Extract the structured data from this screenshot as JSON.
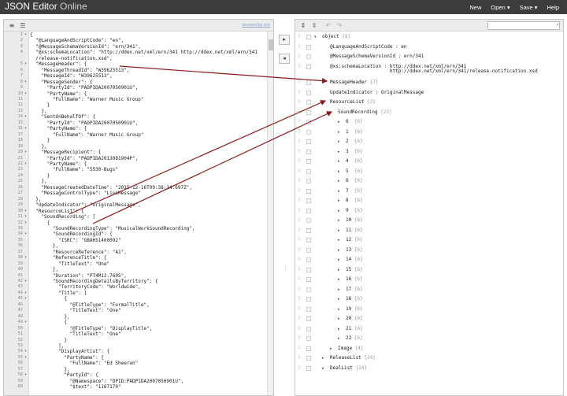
{
  "app": {
    "title_main": "JSON Editor",
    "title_sub": " Online"
  },
  "header_menu": [
    "New",
    "Open ▾",
    "Save ▾",
    "Help"
  ],
  "left_panel": {
    "powered_by": "powered by ace",
    "lines": [
      {
        "n": "1",
        "f": "▾",
        "t": "{"
      },
      {
        "n": "2",
        "f": "",
        "t": "  \"@LanguageAndScriptCode\": \"en\","
      },
      {
        "n": "3",
        "f": "",
        "t": "  \"@MessageSchemaVersionId\": \"ern/341\","
      },
      {
        "n": "4",
        "f": "",
        "t": "  \"@xs:schemaLocation\": \"http://ddex.net/xml/ern/341 http://ddex.net/xml/ern/341"
      },
      {
        "n": "",
        "f": "",
        "t": "  /release-notification.xsd\","
      },
      {
        "n": "5",
        "f": "▾",
        "t": "  \"MessageHeader\": {"
      },
      {
        "n": "6",
        "f": "",
        "t": "    \"MessageThreadId\": \"W39625513\","
      },
      {
        "n": "7",
        "f": "",
        "t": "    \"MessageId\": \"W39625513\","
      },
      {
        "n": "8",
        "f": "▾",
        "t": "    \"MessageSender\": {"
      },
      {
        "n": "9",
        "f": "",
        "t": "      \"PartyId\": \"PADPIDA2007050901U\","
      },
      {
        "n": "10",
        "f": "▾",
        "t": "      \"PartyName\": {"
      },
      {
        "n": "11",
        "f": "",
        "t": "        \"FullName\": \"Warner Music Group\""
      },
      {
        "n": "12",
        "f": "",
        "t": "      }"
      },
      {
        "n": "13",
        "f": "",
        "t": "    },"
      },
      {
        "n": "14",
        "f": "▾",
        "t": "    \"SentOnBehalfOf\": {"
      },
      {
        "n": "15",
        "f": "",
        "t": "      \"PartyId\": \"PADPIDA2007050901U\","
      },
      {
        "n": "16",
        "f": "▾",
        "t": "      \"PartyName\": {"
      },
      {
        "n": "17",
        "f": "",
        "t": "        \"FullName\": \"Warner Music Group\""
      },
      {
        "n": "18",
        "f": "",
        "t": "      }"
      },
      {
        "n": "19",
        "f": "",
        "t": "    },"
      },
      {
        "n": "20",
        "f": "▾",
        "t": "    \"MessageRecipient\": {"
      },
      {
        "n": "21",
        "f": "",
        "t": "      \"PartyId\": \"PADPIDA2013081904P\","
      },
      {
        "n": "22",
        "f": "▾",
        "t": "      \"PartyName\": {"
      },
      {
        "n": "23",
        "f": "",
        "t": "        \"FullName\": \"5530-Bugs\""
      },
      {
        "n": "24",
        "f": "",
        "t": "      }"
      },
      {
        "n": "25",
        "f": "",
        "t": "    },"
      },
      {
        "n": "26",
        "f": "",
        "t": "    \"MessageCreatedDateTime\": \"2015-12-16T09:38:14.697Z\","
      },
      {
        "n": "27",
        "f": "",
        "t": "    \"MessageControlType\": \"LiveMessage\""
      },
      {
        "n": "28",
        "f": "",
        "t": "  },"
      },
      {
        "n": "29",
        "f": "",
        "t": "  \"UpdateIndicator\": \"OriginalMessage\","
      },
      {
        "n": "30",
        "f": "▾",
        "t": "  \"ResourceList\": {"
      },
      {
        "n": "31",
        "f": "▾",
        "t": "    \"SoundRecording\": ["
      },
      {
        "n": "32",
        "f": "▾",
        "t": "      {"
      },
      {
        "n": "33",
        "f": "",
        "t": "        \"SoundRecordingType\": \"MusicalWorkSoundRecording\","
      },
      {
        "n": "34",
        "f": "▾",
        "t": "        \"SoundRecordingId\": {"
      },
      {
        "n": "35",
        "f": "",
        "t": "          \"ISRC\": \"GBAHS1400092\""
      },
      {
        "n": "36",
        "f": "",
        "t": "        },"
      },
      {
        "n": "37",
        "f": "",
        "t": "        \"ResourceReference\": \"A1\","
      },
      {
        "n": "38",
        "f": "▾",
        "t": "        \"ReferenceTitle\": {"
      },
      {
        "n": "39",
        "f": "",
        "t": "          \"TitleText\": \"One\""
      },
      {
        "n": "40",
        "f": "",
        "t": "        },"
      },
      {
        "n": "41",
        "f": "",
        "t": "        \"Duration\": \"PT4M12.760S\","
      },
      {
        "n": "42",
        "f": "▾",
        "t": "        \"SoundRecordingDetailsByTerritory\": {"
      },
      {
        "n": "43",
        "f": "",
        "t": "          \"TerritoryCode\": \"Worldwide\","
      },
      {
        "n": "44",
        "f": "▾",
        "t": "          \"Title\": ["
      },
      {
        "n": "45",
        "f": "▾",
        "t": "            {"
      },
      {
        "n": "46",
        "f": "",
        "t": "              \"@TitleType\": \"FormalTitle\","
      },
      {
        "n": "47",
        "f": "",
        "t": "              \"TitleText\": \"One\""
      },
      {
        "n": "48",
        "f": "",
        "t": "            },"
      },
      {
        "n": "49",
        "f": "▾",
        "t": "            {"
      },
      {
        "n": "50",
        "f": "",
        "t": "              \"@TitleType\": \"DisplayTitle\","
      },
      {
        "n": "51",
        "f": "",
        "t": "              \"TitleText\": \"One\""
      },
      {
        "n": "52",
        "f": "",
        "t": "            }"
      },
      {
        "n": "53",
        "f": "",
        "t": "          ],"
      },
      {
        "n": "54",
        "f": "▾",
        "t": "          \"DisplayArtist\": {"
      },
      {
        "n": "55",
        "f": "▾",
        "t": "            \"PartyName\": {"
      },
      {
        "n": "56",
        "f": "",
        "t": "              \"FullName\": \"Ed Sheeran\""
      },
      {
        "n": "57",
        "f": "",
        "t": "            },"
      },
      {
        "n": "58",
        "f": "▾",
        "t": "            \"PartyId\": {"
      },
      {
        "n": "59",
        "f": "",
        "t": "              \"@Namespace\": \"DPID:PADPIDA2007050901U\","
      },
      {
        "n": "60",
        "f": "",
        "t": "              \"$text\": \"1167170\""
      }
    ]
  },
  "middle_buttons": [
    "▸",
    "◂"
  ],
  "right_panel": {
    "search_placeholder": "",
    "tree": [
      {
        "indent": 0,
        "exp": "▾",
        "key": "object",
        "meta": " {8}"
      },
      {
        "indent": 1,
        "exp": "",
        "key": "@LanguageAndScriptCode : en",
        "meta": ""
      },
      {
        "indent": 1,
        "exp": "",
        "key": "@MessageSchemaVersionId : ern/341",
        "meta": ""
      },
      {
        "indent": 1,
        "exp": "",
        "key": "@xs:schemaLocation : http://ddex.net/xml/ern/341",
        "meta": ""
      },
      {
        "indent": 1,
        "exp": "",
        "key": "                     http://ddex.net/xml/ern/341/release-notification.xsd",
        "meta": "",
        "cont": true
      },
      {
        "indent": 1,
        "exp": "▸",
        "key": "MessageHeader",
        "meta": " {7}"
      },
      {
        "indent": 1,
        "exp": "",
        "key": "UpdateIndicator : OriginalMessage",
        "meta": ""
      },
      {
        "indent": 1,
        "exp": "▾",
        "key": "ResourceList",
        "meta": " {2}"
      },
      {
        "indent": 2,
        "exp": "▾",
        "key": "SoundRecording",
        "meta": " [23]"
      },
      {
        "indent": 3,
        "exp": "▸",
        "key": "0",
        "meta": "  {6}"
      },
      {
        "indent": 3,
        "exp": "▸",
        "key": "1",
        "meta": "  {6}"
      },
      {
        "indent": 3,
        "exp": "▸",
        "key": "2",
        "meta": "  {6}"
      },
      {
        "indent": 3,
        "exp": "▸",
        "key": "3",
        "meta": "  {6}"
      },
      {
        "indent": 3,
        "exp": "▸",
        "key": "4",
        "meta": "  {6}"
      },
      {
        "indent": 3,
        "exp": "▸",
        "key": "5",
        "meta": "  {6}"
      },
      {
        "indent": 3,
        "exp": "▸",
        "key": "6",
        "meta": "  {6}"
      },
      {
        "indent": 3,
        "exp": "▸",
        "key": "7",
        "meta": "  {6}"
      },
      {
        "indent": 3,
        "exp": "▸",
        "key": "8",
        "meta": "  {6}"
      },
      {
        "indent": 3,
        "exp": "▸",
        "key": "9",
        "meta": "  {6}"
      },
      {
        "indent": 3,
        "exp": "▸",
        "key": "10",
        "meta": " {6}"
      },
      {
        "indent": 3,
        "exp": "▸",
        "key": "11",
        "meta": " {6}"
      },
      {
        "indent": 3,
        "exp": "▸",
        "key": "12",
        "meta": " {6}"
      },
      {
        "indent": 3,
        "exp": "▸",
        "key": "13",
        "meta": " {6}"
      },
      {
        "indent": 3,
        "exp": "▸",
        "key": "14",
        "meta": " {6}"
      },
      {
        "indent": 3,
        "exp": "▸",
        "key": "15",
        "meta": " {6}"
      },
      {
        "indent": 3,
        "exp": "▸",
        "key": "16",
        "meta": " {6}"
      },
      {
        "indent": 3,
        "exp": "▸",
        "key": "17",
        "meta": " {6}"
      },
      {
        "indent": 3,
        "exp": "▸",
        "key": "18",
        "meta": " {6}"
      },
      {
        "indent": 3,
        "exp": "▸",
        "key": "19",
        "meta": " {6}"
      },
      {
        "indent": 3,
        "exp": "▸",
        "key": "20",
        "meta": " {6}"
      },
      {
        "indent": 3,
        "exp": "▸",
        "key": "21",
        "meta": " {6}"
      },
      {
        "indent": 3,
        "exp": "▸",
        "key": "22",
        "meta": " {6}"
      },
      {
        "indent": 2,
        "exp": "▸",
        "key": "Image",
        "meta": " {4}"
      },
      {
        "indent": 1,
        "exp": "▸",
        "key": "ReleaseList",
        "meta": " {24}"
      },
      {
        "indent": 1,
        "exp": "▸",
        "key": "DealList",
        "meta": " {24}"
      }
    ]
  },
  "colors": {
    "header_bg": "#3c3c3c",
    "annotation_arrow": "#8b1a1a",
    "meta_text": "#999999"
  }
}
